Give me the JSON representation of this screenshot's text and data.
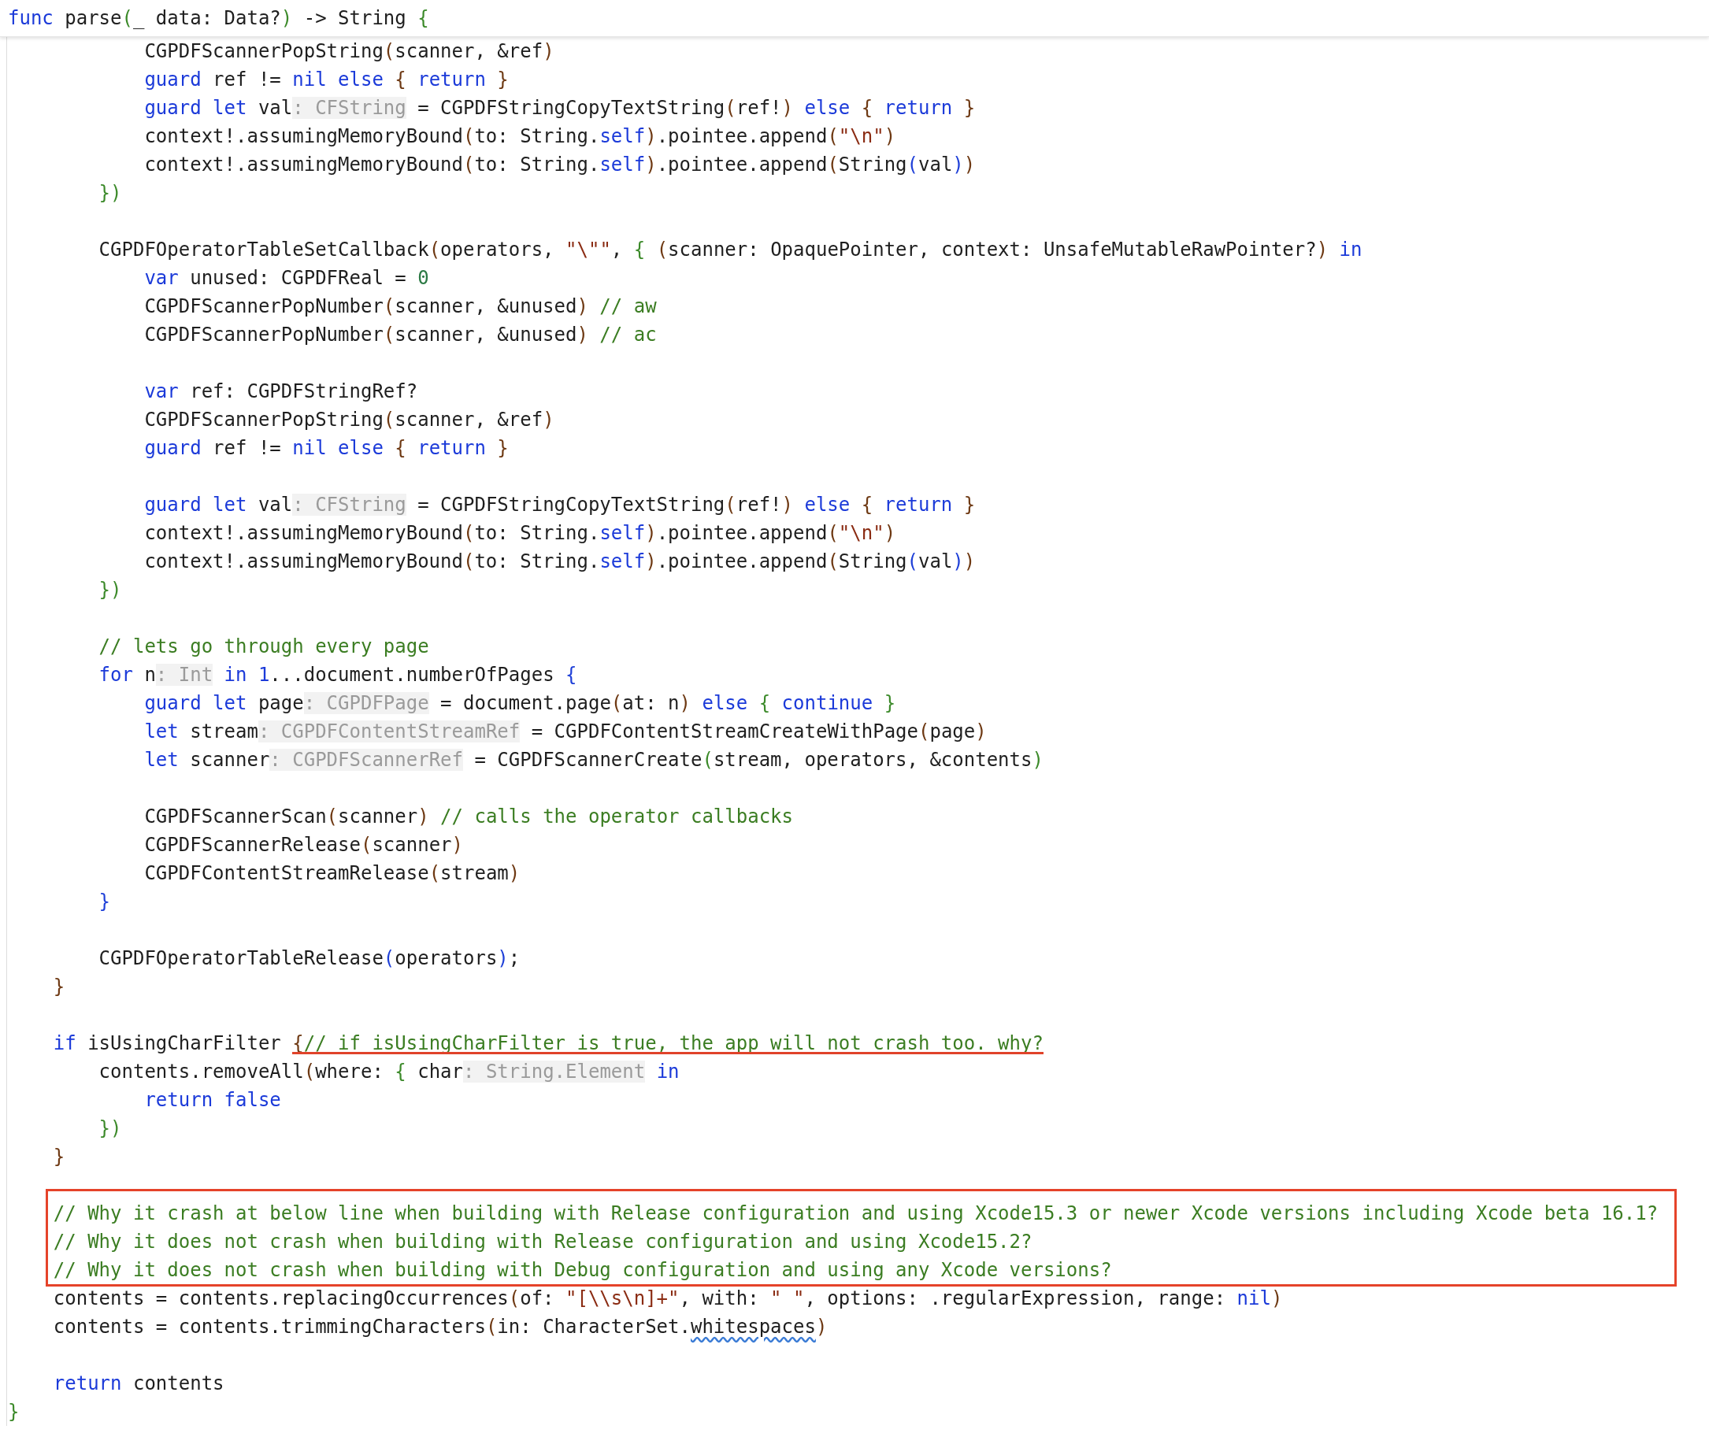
{
  "editor": {
    "header": {
      "tokens": [
        {
          "kind": "keyword",
          "text": "func"
        },
        {
          "kind": "plain",
          "text": " parse"
        },
        {
          "kind": "brace",
          "text": "("
        },
        {
          "kind": "plain",
          "text": "_ data: Data?"
        },
        {
          "kind": "brace",
          "text": ")"
        },
        {
          "kind": "plain",
          "text": " -> String "
        },
        {
          "kind": "brace",
          "text": "{"
        }
      ]
    },
    "lines": [
      {
        "kind": "line",
        "tokens": [
          {
            "kind": "plain",
            "text": "            CGPDFScannerPopString"
          },
          {
            "kind": "paren",
            "text": "("
          },
          {
            "kind": "plain",
            "text": "scanner, &ref"
          },
          {
            "kind": "paren",
            "text": ")"
          }
        ]
      },
      {
        "kind": "line",
        "tokens": [
          {
            "kind": "keyword",
            "text": "            guard"
          },
          {
            "kind": "plain",
            "text": " ref != "
          },
          {
            "kind": "keyword",
            "text": "nil else "
          },
          {
            "kind": "paren",
            "text": "{"
          },
          {
            "kind": "keyword",
            "text": " return "
          },
          {
            "kind": "paren",
            "text": "}"
          }
        ]
      },
      {
        "kind": "line",
        "tokens": [
          {
            "kind": "keyword",
            "text": "            guard let"
          },
          {
            "kind": "plain",
            "text": " val"
          },
          {
            "kind": "hint",
            "text": ": CFString"
          },
          {
            "kind": "plain",
            "text": " = CGPDFStringCopyTextString"
          },
          {
            "kind": "paren",
            "text": "("
          },
          {
            "kind": "plain",
            "text": "ref!"
          },
          {
            "kind": "paren",
            "text": ")"
          },
          {
            "kind": "keyword",
            "text": " else "
          },
          {
            "kind": "paren",
            "text": "{"
          },
          {
            "kind": "keyword",
            "text": " return "
          },
          {
            "kind": "paren",
            "text": "}"
          }
        ]
      },
      {
        "kind": "line",
        "tokens": [
          {
            "kind": "plain",
            "text": "            context!.assumingMemoryBound"
          },
          {
            "kind": "paren",
            "text": "("
          },
          {
            "kind": "plain",
            "text": "to: String."
          },
          {
            "kind": "keyword",
            "text": "self"
          },
          {
            "kind": "paren",
            "text": ")"
          },
          {
            "kind": "plain",
            "text": ".pointee.append"
          },
          {
            "kind": "paren",
            "text": "("
          },
          {
            "kind": "string",
            "text": "\"\\n\""
          },
          {
            "kind": "paren",
            "text": ")"
          }
        ]
      },
      {
        "kind": "line",
        "tokens": [
          {
            "kind": "plain",
            "text": "            context!.assumingMemoryBound"
          },
          {
            "kind": "paren",
            "text": "("
          },
          {
            "kind": "plain",
            "text": "to: String."
          },
          {
            "kind": "keyword",
            "text": "self"
          },
          {
            "kind": "paren",
            "text": ")"
          },
          {
            "kind": "plain",
            "text": ".pointee.append"
          },
          {
            "kind": "paren",
            "text": "("
          },
          {
            "kind": "plain",
            "text": "String"
          },
          {
            "kind": "block",
            "text": "("
          },
          {
            "kind": "plain",
            "text": "val"
          },
          {
            "kind": "block",
            "text": ")"
          },
          {
            "kind": "paren",
            "text": ")"
          }
        ]
      },
      {
        "kind": "line",
        "tokens": [
          {
            "kind": "brace",
            "text": "        })"
          }
        ]
      },
      {
        "kind": "blank"
      },
      {
        "kind": "line",
        "tokens": [
          {
            "kind": "plain",
            "text": "        CGPDFOperatorTableSetCallback"
          },
          {
            "kind": "paren",
            "text": "("
          },
          {
            "kind": "plain",
            "text": "operators, "
          },
          {
            "kind": "string",
            "text": "\"\\\"\""
          },
          {
            "kind": "plain",
            "text": ", "
          },
          {
            "kind": "brace",
            "text": "{ "
          },
          {
            "kind": "paren",
            "text": "("
          },
          {
            "kind": "plain",
            "text": "scanner: OpaquePointer, context: UnsafeMutableRawPointer?"
          },
          {
            "kind": "paren",
            "text": ")"
          },
          {
            "kind": "keyword",
            "text": " in"
          }
        ]
      },
      {
        "kind": "line",
        "tokens": [
          {
            "kind": "keyword",
            "text": "            var"
          },
          {
            "kind": "plain",
            "text": " unused: CGPDFReal = "
          },
          {
            "kind": "number",
            "text": "0"
          }
        ]
      },
      {
        "kind": "line",
        "tokens": [
          {
            "kind": "plain",
            "text": "            CGPDFScannerPopNumber"
          },
          {
            "kind": "paren",
            "text": "("
          },
          {
            "kind": "plain",
            "text": "scanner, &unused"
          },
          {
            "kind": "paren",
            "text": ")"
          },
          {
            "kind": "comment",
            "text": " // aw"
          }
        ]
      },
      {
        "kind": "line",
        "tokens": [
          {
            "kind": "plain",
            "text": "            CGPDFScannerPopNumber"
          },
          {
            "kind": "paren",
            "text": "("
          },
          {
            "kind": "plain",
            "text": "scanner, &unused"
          },
          {
            "kind": "paren",
            "text": ")"
          },
          {
            "kind": "comment",
            "text": " // ac"
          }
        ]
      },
      {
        "kind": "blank"
      },
      {
        "kind": "line",
        "tokens": [
          {
            "kind": "keyword",
            "text": "            var"
          },
          {
            "kind": "plain",
            "text": " ref: CGPDFStringRef?"
          }
        ]
      },
      {
        "kind": "line",
        "tokens": [
          {
            "kind": "plain",
            "text": "            CGPDFScannerPopString"
          },
          {
            "kind": "paren",
            "text": "("
          },
          {
            "kind": "plain",
            "text": "scanner, &ref"
          },
          {
            "kind": "paren",
            "text": ")"
          }
        ]
      },
      {
        "kind": "line",
        "tokens": [
          {
            "kind": "keyword",
            "text": "            guard"
          },
          {
            "kind": "plain",
            "text": " ref != "
          },
          {
            "kind": "keyword",
            "text": "nil else "
          },
          {
            "kind": "paren",
            "text": "{"
          },
          {
            "kind": "keyword",
            "text": " return "
          },
          {
            "kind": "paren",
            "text": "}"
          }
        ]
      },
      {
        "kind": "blank"
      },
      {
        "kind": "line",
        "tokens": [
          {
            "kind": "keyword",
            "text": "            guard let"
          },
          {
            "kind": "plain",
            "text": " val"
          },
          {
            "kind": "hint",
            "text": ": CFString"
          },
          {
            "kind": "plain",
            "text": " = CGPDFStringCopyTextString"
          },
          {
            "kind": "paren",
            "text": "("
          },
          {
            "kind": "plain",
            "text": "ref!"
          },
          {
            "kind": "paren",
            "text": ")"
          },
          {
            "kind": "keyword",
            "text": " else "
          },
          {
            "kind": "paren",
            "text": "{"
          },
          {
            "kind": "keyword",
            "text": " return "
          },
          {
            "kind": "paren",
            "text": "}"
          }
        ]
      },
      {
        "kind": "line",
        "tokens": [
          {
            "kind": "plain",
            "text": "            context!.assumingMemoryBound"
          },
          {
            "kind": "paren",
            "text": "("
          },
          {
            "kind": "plain",
            "text": "to: String."
          },
          {
            "kind": "keyword",
            "text": "self"
          },
          {
            "kind": "paren",
            "text": ")"
          },
          {
            "kind": "plain",
            "text": ".pointee.append"
          },
          {
            "kind": "paren",
            "text": "("
          },
          {
            "kind": "string",
            "text": "\"\\n\""
          },
          {
            "kind": "paren",
            "text": ")"
          }
        ]
      },
      {
        "kind": "line",
        "tokens": [
          {
            "kind": "plain",
            "text": "            context!.assumingMemoryBound"
          },
          {
            "kind": "paren",
            "text": "("
          },
          {
            "kind": "plain",
            "text": "to: String."
          },
          {
            "kind": "keyword",
            "text": "self"
          },
          {
            "kind": "paren",
            "text": ")"
          },
          {
            "kind": "plain",
            "text": ".pointee.append"
          },
          {
            "kind": "paren",
            "text": "("
          },
          {
            "kind": "plain",
            "text": "String"
          },
          {
            "kind": "block",
            "text": "("
          },
          {
            "kind": "plain",
            "text": "val"
          },
          {
            "kind": "block",
            "text": ")"
          },
          {
            "kind": "paren",
            "text": ")"
          }
        ]
      },
      {
        "kind": "line",
        "tokens": [
          {
            "kind": "brace",
            "text": "        })"
          }
        ]
      },
      {
        "kind": "blank"
      },
      {
        "kind": "line",
        "tokens": [
          {
            "kind": "comment",
            "text": "        // lets go through every page"
          }
        ]
      },
      {
        "kind": "line",
        "tokens": [
          {
            "kind": "keyword",
            "text": "        for"
          },
          {
            "kind": "plain",
            "text": " n"
          },
          {
            "kind": "hint",
            "text": ": Int"
          },
          {
            "kind": "keyword",
            "text": " in 1"
          },
          {
            "kind": "plain",
            "text": "...document.numberOfPages "
          },
          {
            "kind": "block",
            "text": "{"
          }
        ]
      },
      {
        "kind": "line",
        "tokens": [
          {
            "kind": "keyword",
            "text": "            guard let"
          },
          {
            "kind": "plain",
            "text": " page"
          },
          {
            "kind": "hint",
            "text": ": CGPDFPage"
          },
          {
            "kind": "plain",
            "text": " = document.page"
          },
          {
            "kind": "paren",
            "text": "("
          },
          {
            "kind": "plain",
            "text": "at: n"
          },
          {
            "kind": "paren",
            "text": ")"
          },
          {
            "kind": "keyword",
            "text": " else "
          },
          {
            "kind": "brace",
            "text": "{"
          },
          {
            "kind": "keyword",
            "text": " continue "
          },
          {
            "kind": "brace",
            "text": "}"
          }
        ]
      },
      {
        "kind": "line",
        "tokens": [
          {
            "kind": "keyword",
            "text": "            let"
          },
          {
            "kind": "plain",
            "text": " stream"
          },
          {
            "kind": "hint",
            "text": ": CGPDFContentStreamRef"
          },
          {
            "kind": "plain",
            "text": " = CGPDFContentStreamCreateWithPage"
          },
          {
            "kind": "paren",
            "text": "("
          },
          {
            "kind": "plain",
            "text": "page"
          },
          {
            "kind": "paren",
            "text": ")"
          }
        ]
      },
      {
        "kind": "line",
        "tokens": [
          {
            "kind": "keyword",
            "text": "            let"
          },
          {
            "kind": "plain",
            "text": " scanner"
          },
          {
            "kind": "hint",
            "text": ": CGPDFScannerRef"
          },
          {
            "kind": "plain",
            "text": " = CGPDFScannerCreate"
          },
          {
            "kind": "brace",
            "text": "("
          },
          {
            "kind": "plain",
            "text": "stream, operators, &contents"
          },
          {
            "kind": "brace",
            "text": ")"
          }
        ]
      },
      {
        "kind": "blank"
      },
      {
        "kind": "line",
        "tokens": [
          {
            "kind": "plain",
            "text": "            CGPDFScannerScan"
          },
          {
            "kind": "paren",
            "text": "("
          },
          {
            "kind": "plain",
            "text": "scanner"
          },
          {
            "kind": "paren",
            "text": ")"
          },
          {
            "kind": "comment",
            "text": " // calls the operator callbacks"
          }
        ]
      },
      {
        "kind": "line",
        "tokens": [
          {
            "kind": "plain",
            "text": "            CGPDFScannerRelease"
          },
          {
            "kind": "paren",
            "text": "("
          },
          {
            "kind": "plain",
            "text": "scanner"
          },
          {
            "kind": "paren",
            "text": ")"
          }
        ]
      },
      {
        "kind": "line",
        "tokens": [
          {
            "kind": "plain",
            "text": "            CGPDFContentStreamRelease"
          },
          {
            "kind": "paren",
            "text": "("
          },
          {
            "kind": "plain",
            "text": "stream"
          },
          {
            "kind": "paren",
            "text": ")"
          }
        ]
      },
      {
        "kind": "line",
        "tokens": [
          {
            "kind": "block",
            "text": "        }"
          }
        ]
      },
      {
        "kind": "blank"
      },
      {
        "kind": "line",
        "tokens": [
          {
            "kind": "plain",
            "text": "        CGPDFOperatorTableRelease"
          },
          {
            "kind": "block",
            "text": "("
          },
          {
            "kind": "plain",
            "text": "operators"
          },
          {
            "kind": "block",
            "text": ")"
          },
          {
            "kind": "plain",
            "text": ";"
          }
        ]
      },
      {
        "kind": "line",
        "tokens": [
          {
            "kind": "paren",
            "text": "    }"
          }
        ]
      },
      {
        "kind": "blank"
      },
      {
        "kind": "annotated",
        "tokens": [
          {
            "kind": "keyword",
            "text": "    if"
          },
          {
            "kind": "plain",
            "text": " isUsingCharFilter "
          }
        ],
        "underlined_tokens": [
          {
            "kind": "paren",
            "text": "{"
          },
          {
            "kind": "comment",
            "text": "// if isUsingCharFilter is true, the app will not crash too. why?"
          }
        ]
      },
      {
        "kind": "line",
        "tokens": [
          {
            "kind": "plain",
            "text": "        contents.removeAll"
          },
          {
            "kind": "paren",
            "text": "("
          },
          {
            "kind": "plain",
            "text": "where: "
          },
          {
            "kind": "brace",
            "text": "{"
          },
          {
            "kind": "plain",
            "text": " char"
          },
          {
            "kind": "hint",
            "text": ": String.Element"
          },
          {
            "kind": "keyword",
            "text": " in"
          }
        ]
      },
      {
        "kind": "line",
        "tokens": [
          {
            "kind": "keyword",
            "text": "            return false"
          }
        ]
      },
      {
        "kind": "line",
        "tokens": [
          {
            "kind": "brace",
            "text": "        })"
          }
        ]
      },
      {
        "kind": "line",
        "tokens": [
          {
            "kind": "paren",
            "text": "    }"
          }
        ]
      },
      {
        "kind": "blank"
      },
      {
        "kind": "boxed",
        "lines": [
          {
            "kind": "line",
            "tokens": [
              {
                "kind": "comment",
                "text": "    // Why it crash at below line when building with Release configuration and using Xcode15.3 or newer Xcode versions including Xcode beta 16.1?"
              }
            ]
          },
          {
            "kind": "line",
            "tokens": [
              {
                "kind": "comment",
                "text": "    // Why it does not crash when building with Release configuration and using Xcode15.2?"
              }
            ]
          },
          {
            "kind": "line",
            "tokens": [
              {
                "kind": "comment",
                "text": "    // Why it does not crash when building with Debug configuration and using any Xcode versions?"
              }
            ]
          }
        ]
      },
      {
        "kind": "line",
        "tokens": [
          {
            "kind": "plain",
            "text": "    contents = contents.replacingOccurrences"
          },
          {
            "kind": "paren",
            "text": "("
          },
          {
            "kind": "plain",
            "text": "of: "
          },
          {
            "kind": "string",
            "text": "\"[\\\\s\\n]+\""
          },
          {
            "kind": "plain",
            "text": ", with: "
          },
          {
            "kind": "string",
            "text": "\" \""
          },
          {
            "kind": "plain",
            "text": ", options: .regularExpression, range: "
          },
          {
            "kind": "keyword",
            "text": "nil"
          },
          {
            "kind": "paren",
            "text": ")"
          }
        ]
      },
      {
        "kind": "line",
        "tokens": [
          {
            "kind": "plain",
            "text": "    contents = contents.trimmingCharacters"
          },
          {
            "kind": "paren",
            "text": "("
          },
          {
            "kind": "plain",
            "text": "in: CharacterSet."
          },
          {
            "kind": "squiggle",
            "text": "whitespaces"
          },
          {
            "kind": "paren",
            "text": ")"
          }
        ]
      },
      {
        "kind": "blank"
      },
      {
        "kind": "line",
        "tokens": [
          {
            "kind": "keyword",
            "text": "    return"
          },
          {
            "kind": "plain",
            "text": " contents"
          }
        ]
      },
      {
        "kind": "line",
        "tokens": [
          {
            "kind": "brace",
            "text": "}"
          }
        ]
      }
    ]
  }
}
